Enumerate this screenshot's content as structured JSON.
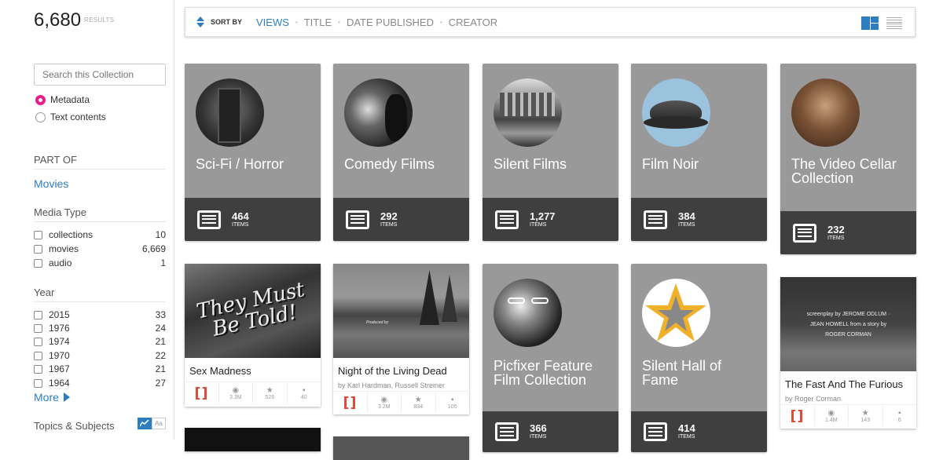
{
  "results": {
    "count": "6,680",
    "label": "RESULTS"
  },
  "search": {
    "placeholder": "Search this Collection"
  },
  "search_mode": [
    {
      "label": "Metadata",
      "selected": true
    },
    {
      "label": "Text contents",
      "selected": false
    }
  ],
  "part_of": {
    "heading": "PART OF",
    "link": "Movies"
  },
  "media_type": {
    "heading": "Media Type",
    "items": [
      {
        "label": "collections",
        "count": "10"
      },
      {
        "label": "movies",
        "count": "6,669"
      },
      {
        "label": "audio",
        "count": "1"
      }
    ]
  },
  "year": {
    "heading": "Year",
    "items": [
      {
        "label": "2015",
        "count": "33"
      },
      {
        "label": "1976",
        "count": "24"
      },
      {
        "label": "1974",
        "count": "21"
      },
      {
        "label": "1970",
        "count": "22"
      },
      {
        "label": "1967",
        "count": "21"
      },
      {
        "label": "1964",
        "count": "27"
      }
    ],
    "more": "More"
  },
  "topics": {
    "heading": "Topics & Subjects",
    "icon_text": "Aa"
  },
  "sort": {
    "label": "SORT BY",
    "options": [
      "VIEWS",
      "TITLE",
      "DATE PUBLISHED",
      "CREATOR"
    ],
    "active": "VIEWS"
  },
  "collections": [
    {
      "title": "Sci-Fi / Horror",
      "count": "464",
      "unit": "ITEMS"
    },
    {
      "title": "Comedy Films",
      "count": "292",
      "unit": "ITEMS"
    },
    {
      "title": "Silent Films",
      "count": "1,277",
      "unit": "ITEMS"
    },
    {
      "title": "Film Noir",
      "count": "384",
      "unit": "ITEMS"
    },
    {
      "title": "The Video Cellar Collection",
      "count": "232",
      "unit": "ITEMS"
    },
    {
      "title": "Picfixer Feature Film Collection",
      "count": "366",
      "unit": "ITEMS"
    },
    {
      "title": "Silent Hall of Fame",
      "count": "414",
      "unit": "ITEMS"
    }
  ],
  "items": [
    {
      "title": "Sex Madness",
      "by": "",
      "views": "3.3M",
      "favs": "526",
      "reviews": "40",
      "thumb_text": "They Must Be Told!"
    },
    {
      "title": "Night of the Living Dead",
      "by": "by Karl Hardman, Russell Streiner",
      "views": "3.2M",
      "favs": "834",
      "reviews": "105",
      "thumb_text": "Produced by"
    },
    {
      "title": "The Fast And The Furious",
      "by": "by Roger Corman",
      "views": "1.4M",
      "favs": "143",
      "reviews": "6",
      "thumb_text": "screenplay by JEROME ODLUM · JEAN HOWELL from a story by ROGER CORMAN"
    }
  ],
  "colors": {
    "accent": "#2c7dc0",
    "radio": "#e91e8a",
    "card": "#999999",
    "card_footer": "#3f3f3f",
    "film_icon": "#e04a3a"
  }
}
